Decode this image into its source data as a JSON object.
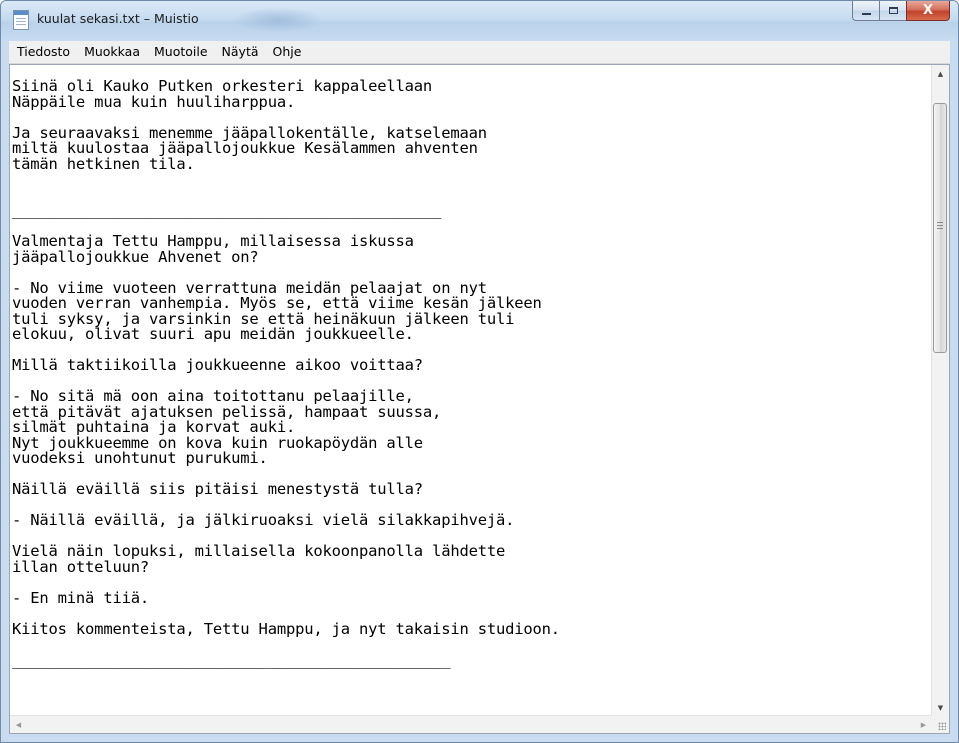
{
  "window": {
    "title": "kuulat sekasi.txt – Muistio",
    "close_symbol": "X"
  },
  "menu": {
    "items": [
      "Tiedosto",
      "Muokkaa",
      "Muotoile",
      "Näytä",
      "Ohje"
    ]
  },
  "document": {
    "text": "Siinä oli Kauko Putken orkesteri kappaleellaan\nNäppäile mua kuin huuliharppua.\n\nJa seuraavaksi menemme jääpallokentälle, katselemaan\nmiltä kuulostaa jääpallojoukkue Kesälammen ahventen\ntämän hetkinen tila.\n\n\n_______________________________________________\n\nValmentaja Tettu Hamppu, millaisessa iskussa\njääpallojoukkue Ahvenet on?\n\n- No viime vuoteen verrattuna meidän pelaajat on nyt\nvuoden verran vanhempia. Myös se, että viime kesän jälkeen\ntuli syksy, ja varsinkin se että heinäkuun jälkeen tuli\nelokuu, olivat suuri apu meidän joukkueelle.\n\nMillä taktiikoilla joukkueenne aikoo voittaa?\n\n- No sitä mä oon aina toitottanu pelaajille,\nettä pitävät ajatuksen pelissä, hampaat suussa,\nsilmät puhtaina ja korvat auki.\nNyt joukkueemme on kova kuin ruokapöydän alle\nvuodeksi unohtunut purukumi.\n\nNäillä eväillä siis pitäisi menestystä tulla?\n\n- Näillä eväillä, ja jälkiruoaksi vielä silakkapihvejä.\n\nVielä näin lopuksi, millaisella kokoonpanolla lähdette\nillan otteluun?\n\n- En minä tiiä.\n\nKiitos kommenteista, Tettu Hamppu, ja nyt takaisin studioon.\n\n________________________________________________"
  },
  "icons": {
    "app": "notepad-icon",
    "minimize": "minimize-icon",
    "maximize": "maximize-icon",
    "close": "close-icon"
  },
  "scrollbar": {
    "up_arrow": "▲",
    "down_arrow": "▼",
    "left_arrow": "◀",
    "right_arrow": "▶"
  }
}
